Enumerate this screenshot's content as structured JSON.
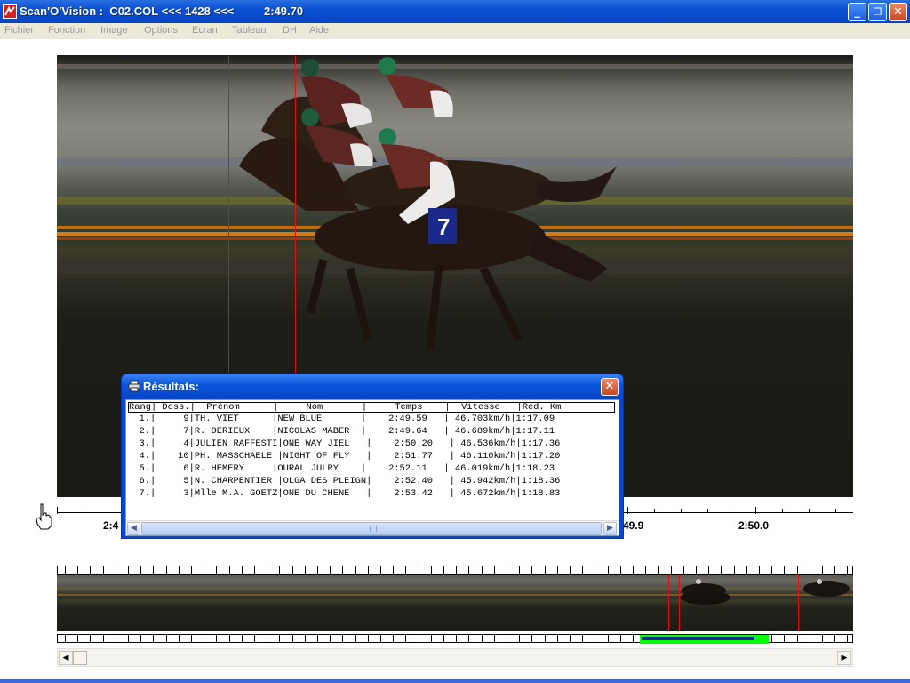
{
  "window": {
    "title": "Scan'O'Vision :  C02.COL <<< 1428 <<<",
    "time": "2:49.70",
    "buttons": {
      "minimize": "_",
      "restore": "❐",
      "close": "✕"
    }
  },
  "menu": {
    "items": [
      "Fichier",
      "Fonction",
      "Image",
      "Options",
      "Ecran",
      "Tableau",
      "DH",
      "Aide"
    ]
  },
  "photo": {
    "saddle_number": "7"
  },
  "timeline": {
    "labels": [
      "2:4",
      "49.9",
      "2:50.0"
    ]
  },
  "results": {
    "title": "Résultats:",
    "close": "✕",
    "header": "Rang| Doss.|  Prénom      |     Nom       |     Temps    |  Vitesse   |Réd. Km",
    "rows": [
      "  1.|     9|TH. VIET      |NEW BLUE       |    2:49.59   | 46.703km/h|1:17.09",
      "  2.|     7|R. DERIEUX    |NICOLAS MABER  |    2:49.64   | 46.689km/h|1:17.11",
      "  3.|     4|JULIEN RAFFESTI|ONE WAY JIEL   |    2:50.20   | 46.536km/h|1:17.36",
      "  4.|    10|PH. MASSCHAELE |NIGHT OF FLY   |    2:51.77   | 46.110km/h|1:17.20",
      "  5.|     6|R. HEMERY     |OURAL JULRY    |    2:52.11   | 46.019km/h|1:18.23",
      "  6.|     5|N. CHARPENTIER |OLGA DES PLEIGN|    2:52.40   | 45.942km/h|1:18.36",
      "  7.|     3|Mlle M.A. GOETZ|ONE DU CHENE   |    2:53.42   | 45.672km/h|1:18.83"
    ],
    "scroll_left": "◀",
    "scroll_right": "▶"
  },
  "bottom_scroll": {
    "left": "◀",
    "right": "▶"
  },
  "colors": {
    "finish_line": "#e01010",
    "selection_green": "#00ff00",
    "selection_blue": "#0a2a96",
    "xp_blue": "#0a4fd4"
  },
  "icons": {
    "app": "app-logo-icon",
    "results": "printer-icon",
    "cursor": "hand-pointer-icon"
  }
}
